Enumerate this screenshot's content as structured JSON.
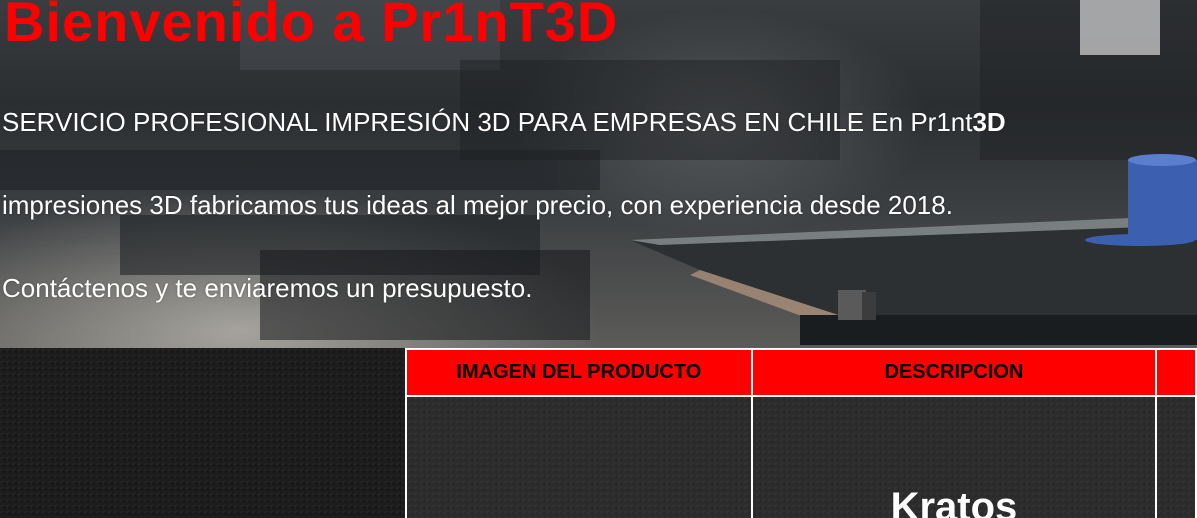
{
  "hero": {
    "title": "Bienvenido a Pr1nT3D",
    "line1_text": "SERVICIO PROFESIONAL IMPRESIÓN 3D PARA EMPRESAS EN CHILE En Pr1nt",
    "line1_bold": "3D",
    "line2": "impresiones 3D fabricamos tus ideas al mejor precio, con experiencia desde 2018.",
    "line3": "Contáctenos y te enviaremos un presupuesto."
  },
  "table": {
    "headers": [
      "IMAGEN DEL PRODUCTO",
      "DESCRIPCION",
      ""
    ],
    "rows": [
      {
        "image": "",
        "description": "Kratos"
      }
    ]
  },
  "colors": {
    "title": "#ff0000",
    "header_bg": "#ff0000",
    "header_text": "#000000",
    "body_text": "#ffffff"
  }
}
